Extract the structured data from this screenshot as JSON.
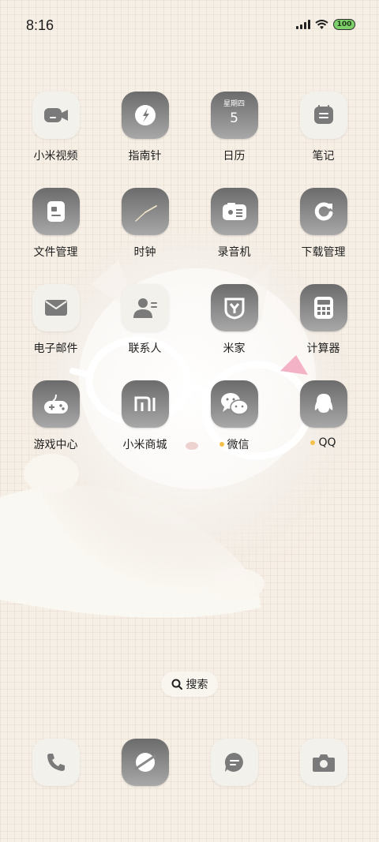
{
  "status_bar": {
    "time": "8:16",
    "battery": "100",
    "battery_color": "#7ed06a"
  },
  "apps": [
    {
      "label": "小米视频",
      "icon": "video-camera-icon",
      "dot": false
    },
    {
      "label": "指南针",
      "icon": "compass-icon",
      "dot": false
    },
    {
      "label": "日历",
      "icon": "calendar-icon",
      "dot": false,
      "weekday": "星期四",
      "day": "5"
    },
    {
      "label": "笔记",
      "icon": "notes-icon",
      "dot": false
    },
    {
      "label": "文件管理",
      "icon": "file-manager-icon",
      "dot": false
    },
    {
      "label": "时钟",
      "icon": "clock-icon",
      "dot": false
    },
    {
      "label": "录音机",
      "icon": "recorder-icon",
      "dot": false
    },
    {
      "label": "下载管理",
      "icon": "download-icon",
      "dot": false
    },
    {
      "label": "电子邮件",
      "icon": "email-icon",
      "dot": false
    },
    {
      "label": "联系人",
      "icon": "contacts-icon",
      "dot": false
    },
    {
      "label": "米家",
      "icon": "mijia-icon",
      "dot": false
    },
    {
      "label": "计算器",
      "icon": "calculator-icon",
      "dot": false
    },
    {
      "label": "游戏中心",
      "icon": "game-center-icon",
      "dot": false
    },
    {
      "label": "小米商城",
      "icon": "mi-store-icon",
      "dot": false
    },
    {
      "label": "微信",
      "icon": "wechat-icon",
      "dot": true
    },
    {
      "label": "QQ",
      "icon": "qq-icon",
      "dot": true
    }
  ],
  "search": {
    "label": "搜索",
    "icon": "search-icon"
  },
  "dock": [
    {
      "icon": "phone-icon"
    },
    {
      "icon": "browser-icon"
    },
    {
      "icon": "messages-icon"
    },
    {
      "icon": "camera-icon"
    }
  ],
  "colors": {
    "notification_dot": "#f5c04a",
    "wallpaper_bg": "#f6efe6"
  }
}
